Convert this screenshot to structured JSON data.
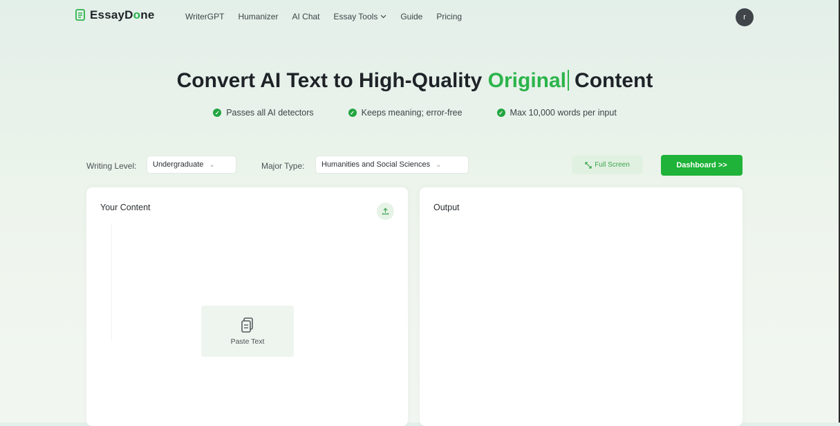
{
  "brand": {
    "name_prefix": "EssayD",
    "name_o": "o",
    "name_suffix": "ne"
  },
  "nav": {
    "items": [
      "WriterGPT",
      "Humanizer",
      "AI Chat",
      "Essay Tools",
      "Guide",
      "Pricing"
    ],
    "dropdown_item_index": 3
  },
  "user": {
    "avatar_letter": "r"
  },
  "hero": {
    "title_prefix": "Convert AI Text to High-Quality",
    "title_accent": "Original",
    "title_suffix": "Content",
    "features": [
      "Passes all AI detectors",
      "Keeps meaning; error-free",
      "Max 10,000 words per input"
    ]
  },
  "controls": {
    "writing_level_label": "Writing Level:",
    "writing_level_value": "Undergraduate",
    "major_type_label": "Major Type:",
    "major_type_value": "Humanities and Social Sciences",
    "full_screen_label": "Full Screen",
    "dashboard_label": "Dashboard >>"
  },
  "input_panel": {
    "title": "Your Content",
    "paste_label": "Paste Text"
  },
  "output_panel": {
    "title": "Output"
  },
  "icons": {
    "logo": "document-icon",
    "check": "check-circle-icon",
    "chevron": "chevron-down-icon",
    "expand": "expand-icon",
    "upload": "upload-icon",
    "paste": "clipboard-icon"
  },
  "colors": {
    "accent": "#2bb44a",
    "button": "#1fb339",
    "avatar": "#3f4549"
  }
}
